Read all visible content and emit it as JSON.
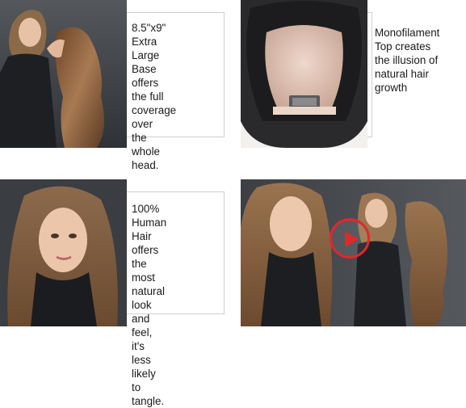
{
  "features": [
    {
      "caption": "8.5\"x9\" Extra\nLarge Base\noffers the full\ncoverage over\nthe whole head."
    },
    {
      "caption": "Monofilament\nTop creates\nthe illusion of\nnatural hair\ngrowth"
    },
    {
      "caption": "100% Human\nHair offers the\nmost natural look\nand feel, it's less\nlikely to tangle."
    }
  ],
  "video": {
    "icon": "play-icon",
    "accent": "#e0282c"
  },
  "colors": {
    "hair": "#8a5a3a",
    "background_dark": "#3a3d42",
    "border": "#cfcfcf"
  }
}
